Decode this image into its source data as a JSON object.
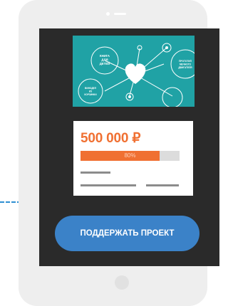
{
  "banner": {
    "bubbles": [
      "КНИГА ДЛЯ ДЕТЕЙ",
      "ПРОТОТИП МЕЧНОГО ДВИГАТЕЛЯ",
      "ВИНОДЕЛ ИЗ КОРЗИНКИ"
    ],
    "center_icon": "heart-icon"
  },
  "funding": {
    "amount": "500 000 ₽",
    "progress_percent": 80,
    "progress_label": "80%"
  },
  "action": {
    "support_label": "ПОДДЕРЖАТЬ ПРОЕКТ"
  },
  "colors": {
    "accent_orange": "#f07032",
    "button_blue": "#3b82c8",
    "banner_teal": "#20a2a5"
  }
}
